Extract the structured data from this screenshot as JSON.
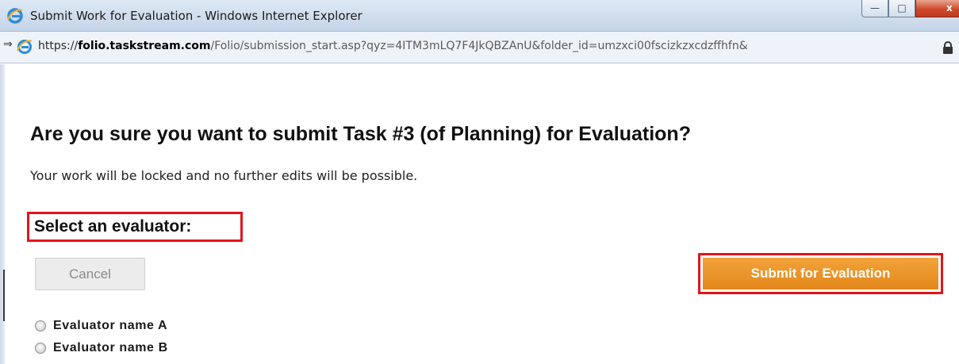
{
  "window": {
    "title": "Submit Work for Evaluation - Windows Internet Explorer",
    "controls": {
      "minimize_glyph": "—",
      "maximize_glyph": "□",
      "close_glyph": "x"
    }
  },
  "address_bar": {
    "scheme": "https://",
    "domain": "folio.taskstream.com",
    "path": "/Folio/submission_start.asp?qyz=4ITM3mLQ7F4JkQBZAnU&folder_id=umzxci00fscizkzxcdzffhfn&"
  },
  "page": {
    "heading": "Are you sure you want to submit Task #3 (of Planning) for Evaluation?",
    "subtext": "Your work will be locked and no further edits will be possible.",
    "select_label": "Select an evaluator:",
    "cancel_label": "Cancel",
    "submit_label": "Submit for Evaluation",
    "evaluators": [
      "Evaluator name A",
      "Evaluator name B"
    ]
  },
  "colors": {
    "highlight": "#e4141b",
    "submit_button": "#e8901f",
    "titlebar": "#cfdcec"
  },
  "icons": {
    "browser": "ie-logo-icon",
    "site": "ie-page-icon",
    "lock": "lock-icon"
  }
}
